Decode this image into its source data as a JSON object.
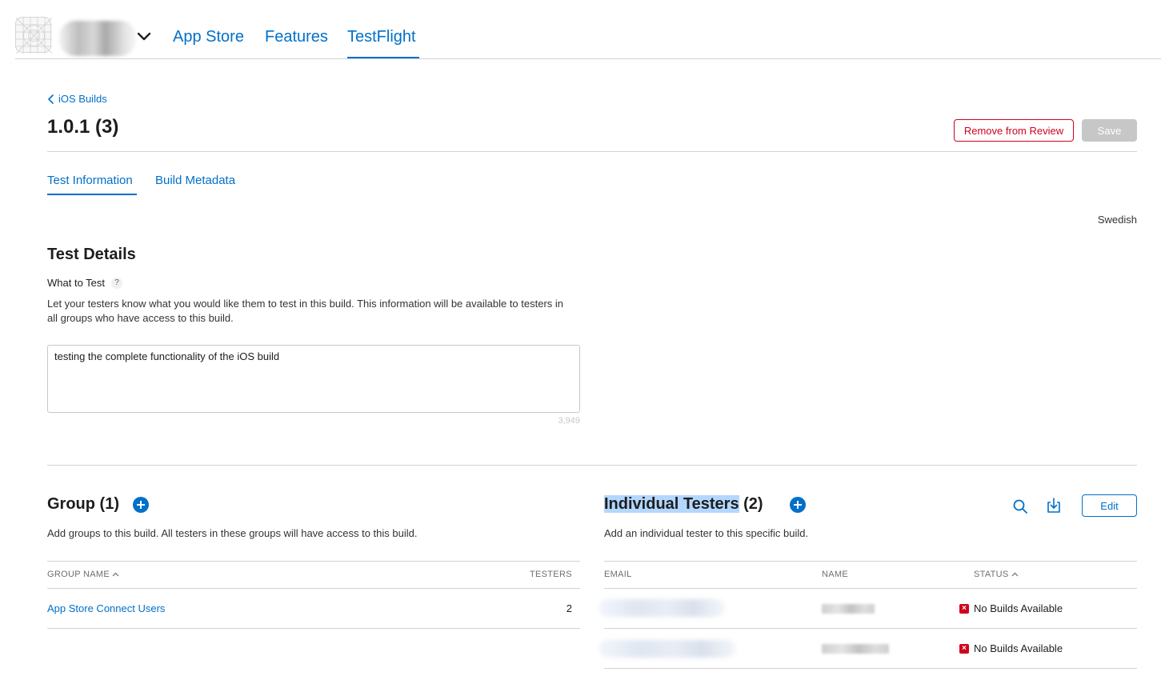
{
  "nav": {
    "tabs": [
      {
        "label": "App Store"
      },
      {
        "label": "Features"
      },
      {
        "label": "TestFlight"
      }
    ],
    "active_tab": "TestFlight"
  },
  "header": {
    "breadcrumb": "iOS Builds",
    "title": "1.0.1 (3)",
    "remove_label": "Remove from Review",
    "save_label": "Save"
  },
  "subtabs": [
    {
      "label": "Test Information"
    },
    {
      "label": "Build Metadata"
    }
  ],
  "language": "Swedish",
  "test_details": {
    "title": "Test Details",
    "field_label": "What to Test",
    "help": "?",
    "description": "Let your testers know what you would like them to test in this build. This information will be available to testers in all groups who have access to this build.",
    "value": "testing the complete functionality of the iOS build",
    "char_count": "3,949"
  },
  "groups": {
    "title": "Group (1)",
    "description": "Add groups to this build. All testers in these groups will have access to this build.",
    "columns": {
      "name": "GROUP NAME",
      "testers": "TESTERS"
    },
    "rows": [
      {
        "name": "App Store Connect Users",
        "testers": "2"
      }
    ]
  },
  "testers": {
    "title_highlight": "Individual Testers",
    "title_count": " (2)",
    "description": "Add an individual tester to this specific build.",
    "edit_label": "Edit",
    "columns": {
      "email": "EMAIL",
      "name": "NAME",
      "status": "STATUS"
    },
    "rows": [
      {
        "status": "No Builds Available"
      },
      {
        "status": "No Builds Available"
      }
    ]
  },
  "colors": {
    "accent": "#0070c9",
    "danger": "#d0021b",
    "disabled": "#c7c7c7",
    "selection": "#b3d7fe"
  }
}
